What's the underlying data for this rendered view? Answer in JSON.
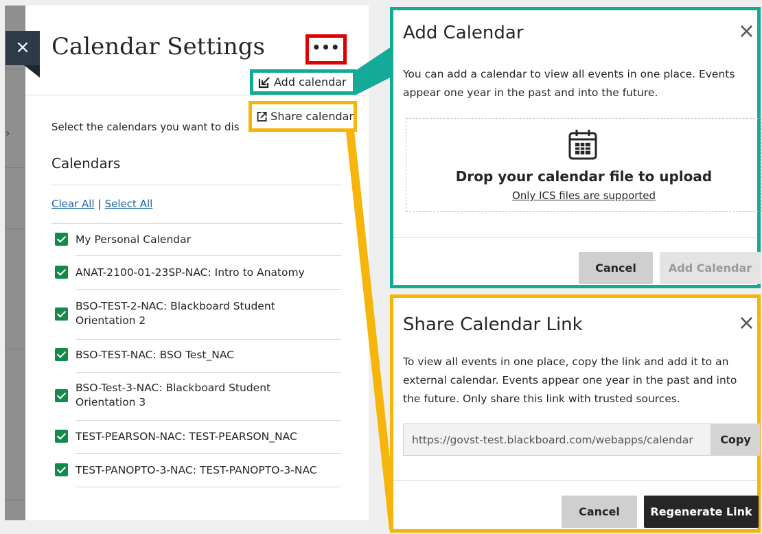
{
  "settings_panel": {
    "close_glyph": "×",
    "title": "Calendar Settings",
    "more_glyph": "•••",
    "menu": {
      "add_label": "Add calendar",
      "share_label": "Share calendar"
    },
    "description": "Select the calendars you want to dis",
    "calendars_heading": "Calendars",
    "clear_all": "Clear All",
    "separator": "|",
    "select_all": "Select All",
    "calendars": [
      {
        "line1": "My Personal Calendar",
        "line2": "",
        "checked": true
      },
      {
        "line1": "ANAT-2100-01-23SP-NAC: Intro to Anatomy",
        "line2": "",
        "checked": true
      },
      {
        "line1": "BSO-TEST-2-NAC: Blackboard Student",
        "line2": "Orientation 2",
        "checked": true
      },
      {
        "line1": "BSO-TEST-NAC: BSO Test_NAC",
        "line2": "",
        "checked": true
      },
      {
        "line1": "BSO-Test-3-NAC: Blackboard Student",
        "line2": "Orientation 3",
        "checked": true
      },
      {
        "line1": "TEST-PEARSON-NAC: TEST-PEARSON_NAC",
        "line2": "",
        "checked": true
      },
      {
        "line1": "TEST-PANOPTO-3-NAC: TEST-PANOPTO-3-NAC",
        "line2": "",
        "checked": true
      }
    ]
  },
  "add_modal": {
    "title": "Add Calendar",
    "close_glyph": "×",
    "body_line1": "You can add a calendar to view all events in one place. Events",
    "body_line2": "appear one year in the past and into the future.",
    "drop_title": "Drop your calendar file to upload",
    "drop_subtitle": "Only ICS files are supported",
    "cancel_label": "Cancel",
    "submit_label": "Add Calendar"
  },
  "share_modal": {
    "title": "Share Calendar Link",
    "close_glyph": "×",
    "body_line1": "To view all events in one place, copy the link and add it to an",
    "body_line2": "external calendar. Events appear one year in the past and into",
    "body_line3": "the future. Only share this link with trusted sources.",
    "link_value": "https://govst-test.blackboard.com/webapps/calendar",
    "copy_label": "Copy",
    "cancel_label": "Cancel",
    "regenerate_label": "Regenerate Link"
  },
  "colors": {
    "highlight_more": "#e00000",
    "highlight_add": "#13aa97",
    "highlight_share": "#f5b50a",
    "checkbox": "#13894a",
    "link": "#1a64a8"
  }
}
